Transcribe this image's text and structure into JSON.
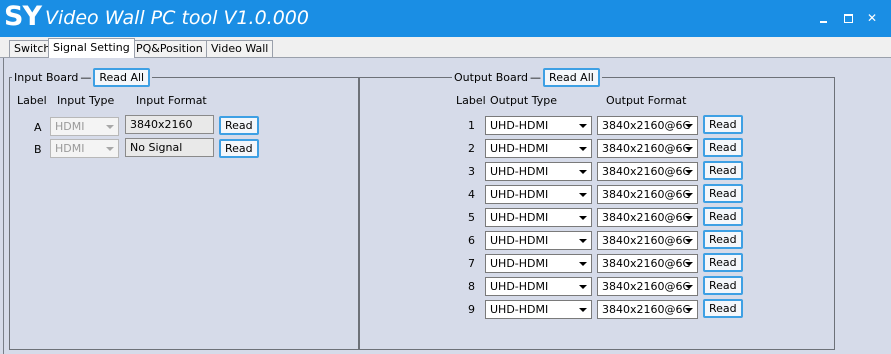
{
  "window": {
    "logo": "SY",
    "title": "Video Wall PC tool V1.0.000"
  },
  "tabs": [
    {
      "label": "Switch",
      "active": false
    },
    {
      "label": "Signal Setting",
      "active": true
    },
    {
      "label": "PQ&Position",
      "active": false
    },
    {
      "label": "Video Wall",
      "active": false
    }
  ],
  "input_board": {
    "title": "Input Board",
    "read_all": "Read All",
    "headers": {
      "label": "Label",
      "type": "Input Type",
      "format": "Input Format"
    },
    "rows": [
      {
        "label": "A",
        "type": "HDMI",
        "format": "3840x2160",
        "read": "Read"
      },
      {
        "label": "B",
        "type": "HDMI",
        "format": "No Signal",
        "read": "Read"
      }
    ]
  },
  "output_board": {
    "title": "Output Board",
    "read_all": "Read All",
    "headers": {
      "label": "Label",
      "type": "Output Type",
      "format": "Output Format"
    },
    "rows": [
      {
        "label": "1",
        "type": "UHD-HDMI",
        "format": "3840x2160@6C",
        "read": "Read"
      },
      {
        "label": "2",
        "type": "UHD-HDMI",
        "format": "3840x2160@6C",
        "read": "Read"
      },
      {
        "label": "3",
        "type": "UHD-HDMI",
        "format": "3840x2160@6C",
        "read": "Read"
      },
      {
        "label": "4",
        "type": "UHD-HDMI",
        "format": "3840x2160@6C",
        "read": "Read"
      },
      {
        "label": "5",
        "type": "UHD-HDMI",
        "format": "3840x2160@6C",
        "read": "Read"
      },
      {
        "label": "6",
        "type": "UHD-HDMI",
        "format": "3840x2160@6C",
        "read": "Read"
      },
      {
        "label": "7",
        "type": "UHD-HDMI",
        "format": "3840x2160@6C",
        "read": "Read"
      },
      {
        "label": "8",
        "type": "UHD-HDMI",
        "format": "3840x2160@6C",
        "read": "Read"
      },
      {
        "label": "9",
        "type": "UHD-HDMI",
        "format": "3840x2160@6C",
        "read": "Read"
      }
    ]
  },
  "colors": {
    "titlebar": "#1a8ee4",
    "background": "#d6dbe9",
    "button_border": "#3ea0e4"
  }
}
